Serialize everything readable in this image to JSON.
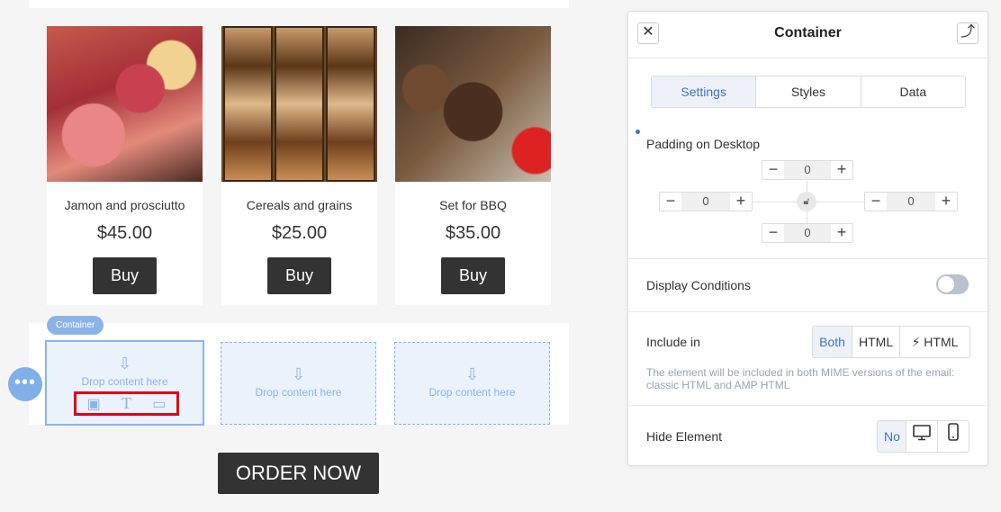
{
  "products": [
    {
      "name": "Jamon and prosciutto",
      "price": "$45.00",
      "button": "Buy"
    },
    {
      "name": "Cereals and grains",
      "price": "$25.00",
      "button": "Buy"
    },
    {
      "name": "Set for BBQ",
      "price": "$35.00",
      "button": "Buy"
    }
  ],
  "container": {
    "badge": "Container",
    "drop_text": "Drop content here",
    "more_glyph": "•••"
  },
  "order_button": "ORDER NOW",
  "panel": {
    "title": "Container",
    "close_glyph": "✕",
    "pin_glyph": "⤴",
    "tabs": [
      "Settings",
      "Styles",
      "Data"
    ],
    "active_tab": "Settings",
    "padding": {
      "label": "Padding on Desktop",
      "top": "0",
      "left": "0",
      "right": "0",
      "bottom": "0"
    },
    "display_conditions": {
      "label": "Display Conditions",
      "enabled": false
    },
    "include_in": {
      "label": "Include in",
      "options": [
        "Both",
        "HTML",
        "HTML"
      ],
      "selected": "Both",
      "hint": "The element will be included in both MIME versions of the email: classic HTML and AMP HTML"
    },
    "hide_element": {
      "label": "Hide Element",
      "options": [
        "No",
        "desktop-icon",
        "mobile-icon"
      ],
      "selected": "No"
    }
  },
  "colors": {
    "accent": "#3d74c4",
    "container_blue": "#8ab4e8",
    "highlight_red": "#e0001a",
    "button_dark": "#333333"
  }
}
